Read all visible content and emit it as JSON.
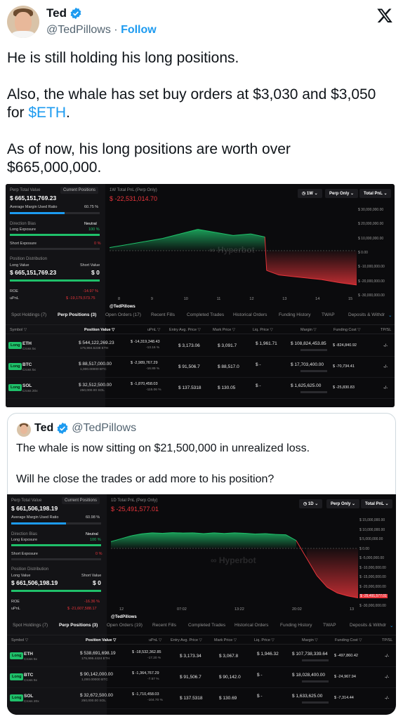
{
  "author": {
    "name": "Ted",
    "handle": "@TedPillows",
    "follow": "Follow"
  },
  "tweet": {
    "p1": "He is still holding his long positions.",
    "p2a": "Also, the whale has set buy orders at $3,030 and $3,050",
    "p2b_prefix": "for ",
    "p2b_link": "$ETH",
    "p2b_suffix": ".",
    "p3a": "As of now, his long positions are worth over",
    "p3b": "$665,000,000."
  },
  "dash1": {
    "perp_total_label": "Perp Total Value",
    "current_positions": "Current Positions",
    "perp_total": "$ 665,151,769.23",
    "margin_label": "Average Margin Used Ratio",
    "margin_val": "60.75 %",
    "margin_pct": 60.75,
    "bias_label": "Direction Bias",
    "bias_val": "Neutral",
    "long_exp_label": "Long Exposure",
    "long_exp_val": "100 %",
    "short_exp_label": "Short Exposure",
    "short_exp_val": "0 %",
    "pos_dist_label": "Position Distribution",
    "long_value_label": "Long Value",
    "short_value_label": "Short Value",
    "long_value": "$ 665,151,769.23",
    "short_value": "$ 0",
    "roe_label": "ROE",
    "roe_val": "-14.97 %",
    "upnl_label": "uPnL",
    "upnl_val": "$ -19,179,573.75",
    "chart_title": "1W Total PnL (Perp Only)",
    "chart_value": "$ -22,531,014.70",
    "btn_range": "1W",
    "btn_perp": "Perp Only",
    "btn_total": "Total PnL",
    "watermark": "Hyperbot",
    "credit": "@TedPillows",
    "tabs": [
      "Spot Holdings (7)",
      "Perp Positions (3)",
      "Open Orders (17)",
      "Recent Fills",
      "Completed Trades",
      "Historical Orders",
      "Funding History",
      "TWAP",
      "Deposits & Withdr"
    ],
    "cols": [
      "Symbol",
      "Position Value",
      "uPnL",
      "Entry Avg. Price",
      "Mark Price",
      "Liq. Price",
      "Margin",
      "Funding Cost",
      "TP/SL"
    ],
    "rows": [
      {
        "tag": "Long",
        "sym": "ETH",
        "sub": "Cross 5x",
        "pv": "$ 544,122,269.23",
        "pvsub": "175,994.5238 ETH",
        "upnl": "$ -14,319,348.43",
        "upnlpct": "-13.16 %",
        "entry": "$ 3,173.06",
        "mark": "$ 3,091.7",
        "liq": "$ 1,961.71",
        "margin": "$ 108,824,453.85",
        "fund": "$ -824,840.92",
        "tpsl": "-/-"
      },
      {
        "tag": "Long",
        "sym": "BTC",
        "sub": "Cross 5x",
        "pv": "$ 88,517,000.00",
        "pvsub": "1,000.00000 BTC",
        "upnl": "$ -2,989,767.29",
        "upnlpct": "-16.89 %",
        "entry": "$ 91,506.7",
        "mark": "$ 88,517.0",
        "liq": "$ -",
        "margin": "$ 17,703,400.00",
        "fund": "$ -70,734.41",
        "tpsl": "-/-"
      },
      {
        "tag": "Long",
        "sym": "SOL",
        "sub": "Cross 20x",
        "pv": "$ 32,512,500.00",
        "pvsub": "250,000.00 SOL",
        "upnl": "$ -1,870,458.03",
        "upnlpct": "-115.06 %",
        "entry": "$ 137.5318",
        "mark": "$ 130.05",
        "liq": "$ -",
        "margin": "$ 1,625,625.00",
        "fund": "$ -25,830.83",
        "tpsl": "-/-"
      }
    ]
  },
  "quote": {
    "name": "Ted",
    "handle": "@TedPillows",
    "line1": "The whale is now sitting on $21,500,000 in unrealized loss.",
    "line2": "Will he close the trades or add more to his position?"
  },
  "dash2": {
    "perp_total_label": "Perp Total Value",
    "current_positions": "Current Positions",
    "perp_total": "$ 661,506,198.19",
    "margin_label": "Average Margin Used Ratio",
    "margin_val": "60.98 %",
    "margin_pct": 60.98,
    "bias_label": "Direction Bias",
    "bias_val": "Neutral",
    "long_exp_label": "Long Exposure",
    "long_exp_val": "100 %",
    "short_exp_label": "Short Exposure",
    "short_exp_val": "0 %",
    "pos_dist_label": "Position Distribution",
    "long_value_label": "Long Value",
    "short_value_label": "Short Value",
    "long_value": "$ 661,506,198.19",
    "short_value": "$ 0",
    "roe_label": "ROE",
    "roe_val": "-16.36 %",
    "upnl_label": "uPnL",
    "upnl_val": "$ -21,607,588.17",
    "chart_title": "1D Total PnL (Perp Only)",
    "chart_value": "$ -25,491,577.01",
    "btn_range": "1D",
    "btn_perp": "Perp Only",
    "btn_total": "Total PnL",
    "watermark": "Hyperbot",
    "credit": "@TedPillows",
    "tabs": [
      "Spot Holdings (7)",
      "Perp Positions (3)",
      "Open Orders (19)",
      "Recent Fills",
      "Completed Trades",
      "Historical Orders",
      "Funding History",
      "TWAP",
      "Deposits & Withdr"
    ],
    "cols": [
      "Symbol",
      "Position Value",
      "uPnL",
      "Entry Avg. Price",
      "Mark Price",
      "Liq. Price",
      "Margin",
      "Funding Cost",
      "TP/SL"
    ],
    "rows": [
      {
        "tag": "Long",
        "sym": "ETH",
        "sub": "Cross 5x",
        "pv": "$ 538,691,698.19",
        "pvsub": "175,995.4424 ETH",
        "upnl": "$ -18,532,362.85",
        "upnlpct": "-17.20 %",
        "entry": "$ 3,173.34",
        "mark": "$ 3,067.8",
        "liq": "$ 1,946.32",
        "margin": "$ 107,738,339.64",
        "fund": "$ -497,860.42",
        "tpsl": "-/-"
      },
      {
        "tag": "Long",
        "sym": "BTC",
        "sub": "Cross 5x",
        "pv": "$ 90,142,000.00",
        "pvsub": "1,000.00000 BTC",
        "upnl": "$ -1,364,767.29",
        "upnlpct": "-7.57 %",
        "entry": "$ 91,506.7",
        "mark": "$ 90,142.0",
        "liq": "$ -",
        "margin": "$ 18,028,400.00",
        "fund": "$ -24,967.94",
        "tpsl": "-/-"
      },
      {
        "tag": "Long",
        "sym": "SOL",
        "sub": "Cross 20x",
        "pv": "$ 32,672,500.00",
        "pvsub": "250,000.00 SOL",
        "upnl": "$ -1,710,458.03",
        "upnlpct": "-104.70 %",
        "entry": "$ 137.5318",
        "mark": "$ 130.69",
        "liq": "$ -",
        "margin": "$ 1,633,625.00",
        "fund": "$ -7,314.44",
        "tpsl": "-/-"
      }
    ]
  },
  "chart_data": [
    {
      "type": "area",
      "title": "1W Total PnL (Perp Only)",
      "x_ticks": [
        "8",
        "9",
        "10",
        "11",
        "12",
        "13",
        "14",
        "15"
      ],
      "y_ticks": [
        "$ 30,000,000.00",
        "$ 20,000,000.00",
        "$ 10,000,000.00",
        "$ 0.00",
        "$ -10,000,000.00",
        "$ -20,000,000.00",
        "$ -30,000,000.00"
      ],
      "ylim": [
        -30000000,
        30000000
      ],
      "x": [
        8,
        8.5,
        9,
        9.5,
        10,
        10.5,
        11,
        11.5,
        12,
        12.4,
        12.45,
        12.8,
        13.2,
        13.6,
        14,
        14.5,
        15
      ],
      "values": [
        2000000,
        4000000,
        6000000,
        8000000,
        11000000,
        14000000,
        12000000,
        10000000,
        11000000,
        9000000,
        -13000000,
        -16000000,
        -17000000,
        -18000000,
        -19000000,
        -21000000,
        -22531014.7
      ],
      "last_label": "$ -22,531,014.70"
    },
    {
      "type": "area",
      "title": "1D Total PnL (Perp Only)",
      "x_ticks": [
        "12",
        "07:02",
        "13:22",
        "20:02",
        "13"
      ],
      "y_ticks": [
        "$ 15,000,000.00",
        "$ 10,000,000.00",
        "$ 5,000,000.00",
        "$ 0.00",
        "$ -5,000,000.00",
        "$ -10,000,000.00",
        "$ -15,000,000.00",
        "$ -20,000,000.00",
        "$ -25,491,577.01",
        "$ -30,000,000.00"
      ],
      "ylim": [
        -30000000,
        17000000
      ],
      "x": [
        0,
        1,
        2,
        3,
        4,
        5,
        6,
        7,
        8,
        9,
        10,
        11,
        12,
        13,
        14,
        15,
        16,
        17,
        18,
        19,
        20,
        21,
        22,
        23,
        24
      ],
      "values": [
        3500000,
        5000000,
        6500000,
        7500000,
        8000000,
        7800000,
        8100000,
        7900000,
        8000000,
        7600000,
        8000000,
        7700000,
        8000000,
        7800000,
        7400000,
        7600000,
        7200000,
        7000000,
        4000000,
        -5000000,
        -14000000,
        -20000000,
        -23000000,
        -24500000,
        -25491577.01
      ],
      "last_label": "$ -25,491,577.01"
    }
  ]
}
